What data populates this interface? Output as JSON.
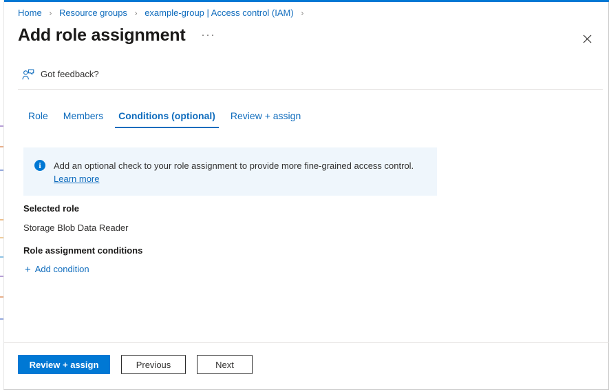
{
  "window": {
    "accent_color": "#0078d4",
    "link_color": "#0f6cbd"
  },
  "breadcrumb": {
    "separator": "›",
    "items": [
      {
        "label": "Home"
      },
      {
        "label": "Resource groups"
      },
      {
        "label": "example-group | Access control (IAM)"
      }
    ],
    "trailing_separator": "›"
  },
  "header": {
    "title": "Add role assignment",
    "ellipsis": "···",
    "close_icon": "close-icon"
  },
  "feedback": {
    "icon": "feedback-person-icon",
    "label": "Got feedback?"
  },
  "tabs": [
    {
      "label": "Role",
      "active": false
    },
    {
      "label": "Members",
      "active": false
    },
    {
      "label": "Conditions (optional)",
      "active": true
    },
    {
      "label": "Review + assign",
      "active": false
    }
  ],
  "info_banner": {
    "icon": "info-icon",
    "text": "Add an optional check to your role assignment to provide more fine-grained access control. ",
    "link_label": "Learn more",
    "background_color": "#eff6fc"
  },
  "content": {
    "selected_role_heading": "Selected role",
    "selected_role_value": "Storage Blob Data Reader",
    "conditions_heading": "Role assignment conditions",
    "add_condition_plus": "+",
    "add_condition_label": "Add condition"
  },
  "footer": {
    "primary_button": "Review + assign",
    "previous_button": "Previous",
    "next_button": "Next"
  }
}
